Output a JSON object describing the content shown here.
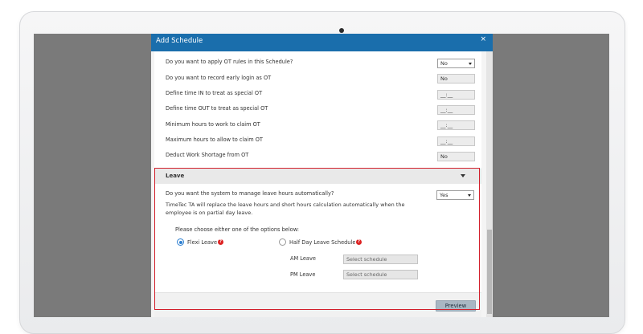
{
  "modal": {
    "title": "Add Schedule",
    "close": "×"
  },
  "ot_rules": [
    {
      "label": "Do you want to apply OT rules in this Schedule?",
      "value": "No",
      "type": "select"
    },
    {
      "label": "Do you want to record early login as OT",
      "value": "No",
      "type": "readonly"
    },
    {
      "label": "Define time IN to treat as special OT",
      "value": "__:__",
      "type": "readonly"
    },
    {
      "label": "Define time OUT to treat as special OT",
      "value": "__:__",
      "type": "readonly"
    },
    {
      "label": "Minimum hours to work to claim OT",
      "value": "__:__",
      "type": "readonly"
    },
    {
      "label": "Maximum hours to allow to claim OT",
      "value": "__:__",
      "type": "readonly"
    },
    {
      "label": "Deduct Work Shortage from OT",
      "value": "No",
      "type": "readonly"
    }
  ],
  "leave": {
    "title": "Leave",
    "question": "Do you want the system to manage leave hours automatically?",
    "answer": "Yes",
    "note": "TimeTec TA will replace the leave hours and short hours calculation automatically when the employee is on partial day leave.",
    "choose_prompt": "Please choose either one of the options below:",
    "option_flexi": "Flexi Leave",
    "option_halfday": "Half Day Leave Schedule",
    "selected_option": "Flexi Leave",
    "am_label": "AM Leave",
    "am_placeholder": "Select schedule",
    "pm_label": "PM Leave",
    "pm_placeholder": "Select schedule",
    "help_glyph": "?"
  },
  "footer": {
    "preview_label": "Preview"
  },
  "colors": {
    "header": "#1a6eac",
    "highlight": "#d21f2b",
    "radio_selected": "#2d7fd0",
    "help_icon": "#dd2222"
  },
  "icons": {
    "close": "close-icon",
    "dropdown": "chevron-down-icon",
    "help": "question-circle-icon"
  }
}
